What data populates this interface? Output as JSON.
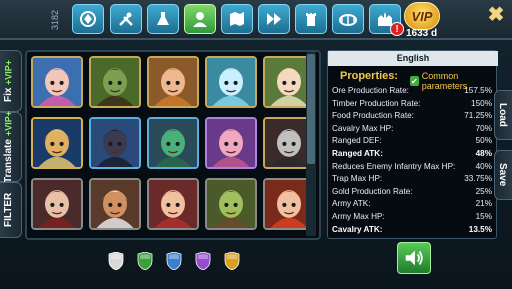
{
  "toolbar": {
    "counter": "3182",
    "icons": [
      "emblem-icon",
      "tools-icon",
      "flask-icon",
      "hero-icon",
      "map-icon",
      "fast-forward-icon",
      "castle-tower-icon",
      "arena-icon",
      "fortress-icon"
    ],
    "active_index": 3,
    "vip_label": "VIP",
    "alert_label": "!",
    "days_label": "1633 d",
    "close_label": "✖"
  },
  "left_tabs": {
    "fix": "Fix",
    "translate": "Translate",
    "filter": "FILTER",
    "vip_badge": "+VIP+"
  },
  "right_tabs": {
    "load": "Load",
    "save": "Save"
  },
  "panel": {
    "language": "English",
    "properties_title": "Properties:",
    "common_parameters": "Common parameters",
    "rows": [
      {
        "label": "Ore Production Rate:",
        "value": "157.5%",
        "bold": false
      },
      {
        "label": "Timber Production Rate:",
        "value": "150%",
        "bold": false
      },
      {
        "label": "Food Production Rate:",
        "value": "71.25%",
        "bold": false
      },
      {
        "label": "Cavalry Max HP:",
        "value": "70%",
        "bold": false
      },
      {
        "label": "Ranged DEF:",
        "value": "50%",
        "bold": false
      },
      {
        "label": "Ranged ATK:",
        "value": "48%",
        "bold": true
      },
      {
        "label": "Reduces Enemy Infantry Max HP:",
        "value": "40%",
        "bold": false
      },
      {
        "label": "Trap Max HP:",
        "value": "33.75%",
        "bold": false
      },
      {
        "label": "Gold Production Rate:",
        "value": "25%",
        "bold": false
      },
      {
        "label": "Army ATK:",
        "value": "21%",
        "bold": false
      },
      {
        "label": "Army Max HP:",
        "value": "15%",
        "bold": false
      },
      {
        "label": "Cavalry ATK:",
        "value": "13.5%",
        "bold": true
      }
    ]
  },
  "heroes": [
    {
      "name": "pink-fairy-hero",
      "bg": "#3c6fb0",
      "frame": "#c8a85a",
      "face": "#f2c6b8",
      "hair": "#e45aa8"
    },
    {
      "name": "orc-warrior-hero",
      "bg": "#4a6a2a",
      "frame": "#c8a85a",
      "face": "#7aa050",
      "hair": "#3a2a18"
    },
    {
      "name": "goggles-engineer-hero",
      "bg": "#8a5a2a",
      "frame": "#c8a85a",
      "face": "#f0b890",
      "hair": "#d07a2a"
    },
    {
      "name": "ice-spirit-hero",
      "bg": "#3a8aa0",
      "frame": "#c8a85a",
      "face": "#c8f0ff",
      "hair": "#8ad8f0"
    },
    {
      "name": "elf-archer-hero",
      "bg": "#5a7a3a",
      "frame": "#c8a85a",
      "face": "#f4d8c0",
      "hair": "#f0e6c0"
    },
    {
      "name": "golden-knight-hero",
      "bg": "#1a3a6a",
      "frame": "#d8b050",
      "face": "#e0b060",
      "hair": "#f0d070"
    },
    {
      "name": "dark-wraith-hero",
      "bg": "#2a4a7a",
      "frame": "#5ab0e0",
      "face": "#3a3a50",
      "hair": "#1a1a2a"
    },
    {
      "name": "dragon-hero",
      "bg": "#2a4a5a",
      "frame": "#5ab0e0",
      "face": "#4ab07a",
      "hair": "#2a6a4a"
    },
    {
      "name": "pink-beast-hero",
      "bg": "#6a3a8a",
      "frame": "#b080e0",
      "face": "#f0a8c0",
      "hair": "#c05a8a"
    },
    {
      "name": "masked-rogue-hero",
      "bg": "#3a2a2a",
      "frame": "#c8a85a",
      "face": "#c0c0c0",
      "hair": "#2a2a2a"
    },
    {
      "name": "hooded-assassin-hero",
      "bg": "#4a2a2a",
      "frame": "#8a8a8a",
      "face": "#e8c0a8",
      "hair": "#802020"
    },
    {
      "name": "bull-warrior-hero",
      "bg": "#5a3a2a",
      "frame": "#8a8a8a",
      "face": "#d09060",
      "hair": "#f0f0f0"
    },
    {
      "name": "red-mage-hero",
      "bg": "#6a2a2a",
      "frame": "#8a8a8a",
      "face": "#f0c0a0",
      "hair": "#b03030"
    },
    {
      "name": "goblin-hero",
      "bg": "#4a5a2a",
      "frame": "#8a8a8a",
      "face": "#a0c060",
      "hair": "#6a4a2a"
    },
    {
      "name": "fire-sorceress-hero",
      "bg": "#7a2a1a",
      "frame": "#8a8a8a",
      "face": "#f0c0a0",
      "hair": "#e04020"
    }
  ],
  "swatches": [
    {
      "name": "white-shield-icon",
      "color": "#d8d8d8"
    },
    {
      "name": "green-shield-icon",
      "color": "#3aa03a"
    },
    {
      "name": "blue-shield-icon",
      "color": "#3a80d0"
    },
    {
      "name": "purple-shield-icon",
      "color": "#9a4ad0"
    },
    {
      "name": "gold-shield-icon",
      "color": "#d8a020"
    }
  ],
  "sound_icon": "speaker-icon"
}
